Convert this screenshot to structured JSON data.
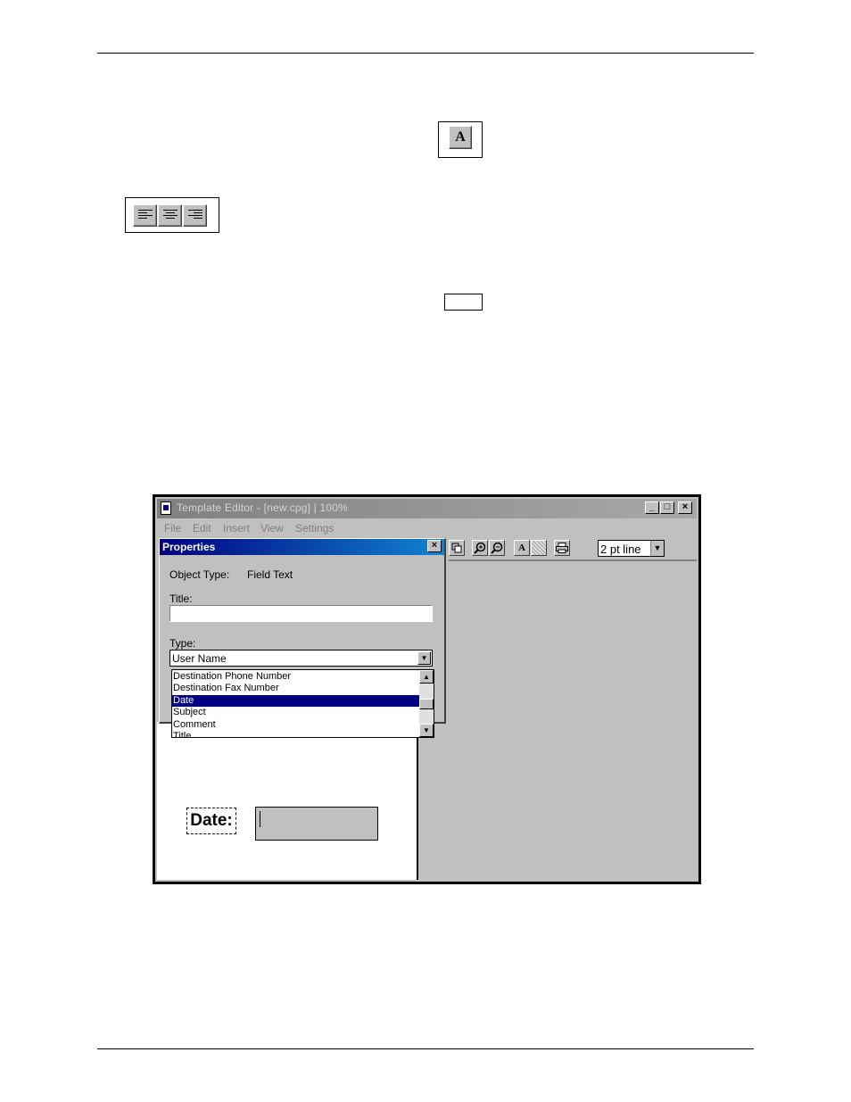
{
  "screenshot": {
    "window_title": "Template Editor - [new.cpg] | 100%",
    "window_buttons": {
      "minimize": "_",
      "maximize": "□",
      "close": "×"
    },
    "menu": [
      "File",
      "Edit",
      "Insert",
      "View",
      "Settings"
    ],
    "toolbar": {
      "text_button": "A",
      "line_select": "2 pt line"
    },
    "properties": {
      "title": "Properties",
      "close": "×",
      "object_type_label": "Object Type:",
      "object_type_value": "Field Text",
      "title_label": "Title:",
      "title_value": "",
      "type_label": "Type:",
      "type_value": "User Name",
      "type_options": [
        "Destination Phone Number",
        "Destination Fax Number",
        "Date",
        "Subject",
        "Comment",
        "Title"
      ],
      "selected_option": "Date"
    },
    "canvas": {
      "date_label": "Date:"
    }
  },
  "figures": {
    "text_tool_icon": "A"
  }
}
